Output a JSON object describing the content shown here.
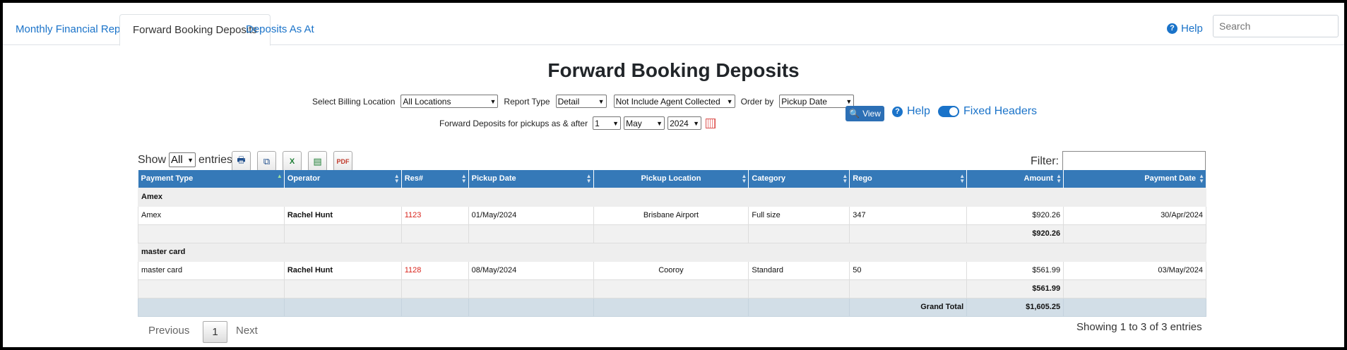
{
  "tabs": [
    {
      "label": "Monthly Financial Reports"
    },
    {
      "label": "Forward Booking Deposits"
    },
    {
      "label": "Deposits As At"
    }
  ],
  "header": {
    "help": "Help",
    "search_placeholder": "Search"
  },
  "title": "Forward Booking Deposits",
  "filters": {
    "billing_label": "Select Billing Location",
    "billing_value": "All Locations",
    "report_type_label": "Report Type",
    "report_type_value": "Detail",
    "agent_value": "Not Include Agent Collected",
    "order_label": "Order by",
    "order_value": "Pickup Date",
    "pickup_label": "Forward Deposits for pickups as & after",
    "day_value": "1",
    "month_value": "May",
    "year_value": "2024",
    "view_button": "View",
    "help": "Help",
    "fixed_headers": "Fixed Headers"
  },
  "table_controls": {
    "show_label": "Show",
    "show_value": "All",
    "entries_label": "entries",
    "filter_label": "Filter:"
  },
  "columns": [
    "Payment Type",
    "Operator",
    "Res#",
    "Pickup Date",
    "Pickup Location",
    "Category",
    "Rego",
    "Amount",
    "Payment Date"
  ],
  "groups": [
    {
      "name": "Amex",
      "rows": [
        {
          "payment_type": "Amex",
          "operator": "Rachel Hunt",
          "res": "1123",
          "pickup_date": "01/May/2024",
          "pickup_location": "Brisbane Airport",
          "category": "Full size",
          "rego": "347",
          "amount": "$920.26",
          "payment_date": "30/Apr/2024"
        }
      ],
      "subtotal": "$920.26"
    },
    {
      "name": "master card",
      "rows": [
        {
          "payment_type": "master card",
          "operator": "Rachel Hunt",
          "res": "1128",
          "pickup_date": "08/May/2024",
          "pickup_location": "Cooroy",
          "category": "Standard",
          "rego": "50",
          "amount": "$561.99",
          "payment_date": "03/May/2024"
        }
      ],
      "subtotal": "$561.99"
    }
  ],
  "grand_total": {
    "label": "Grand Total",
    "value": "$1,605.25"
  },
  "pagination": {
    "previous": "Previous",
    "current": "1",
    "next": "Next",
    "info": "Showing 1 to 3 of 3 entries"
  }
}
